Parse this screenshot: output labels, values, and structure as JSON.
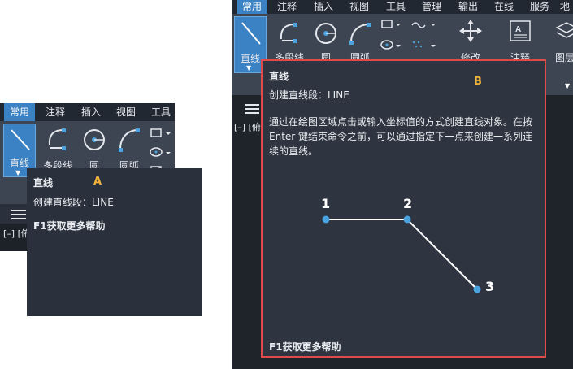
{
  "tabs": [
    "常用",
    "注释",
    "插入",
    "视图",
    "工具",
    "管理",
    "输出",
    "在线",
    "服务",
    "地"
  ],
  "tools": {
    "line": "直线",
    "polyline": "多段线",
    "circle": "圆",
    "arc": "圆弧",
    "modify": "修改",
    "annotation": "注释",
    "layer": "图层"
  },
  "command_prefix": "[–] [俯",
  "tooltip": {
    "title": "直线",
    "command": "创建直线段：LINE",
    "description": "通过在绘图区域点击或输入坐标值的方式创建直线对象。在按 Enter 键结束命令之前，可以通过指定下一点来创建一系列连续的直线。",
    "help": "F1获取更多帮助",
    "points": [
      "1",
      "2",
      "3"
    ]
  },
  "labels": {
    "a": "A",
    "b": "B"
  },
  "colors": {
    "accent": "#3b82c4",
    "highlight": "#e04a4a",
    "point": "#4aa3df",
    "label": "#f0b43a"
  }
}
